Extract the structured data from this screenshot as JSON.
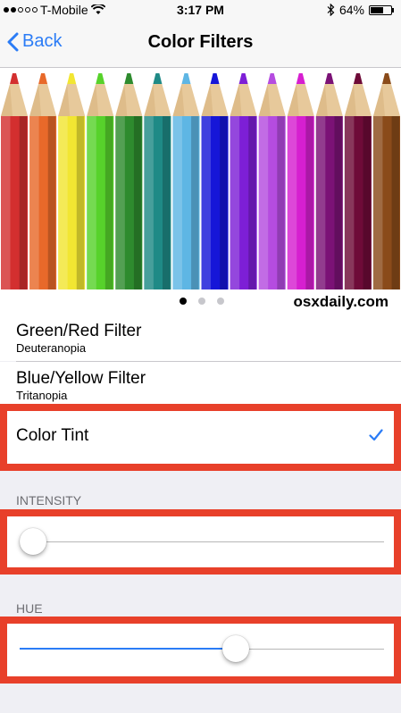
{
  "status_bar": {
    "carrier": "T-Mobile",
    "signal_bars_filled": 2,
    "signal_bars_total": 5,
    "time": "3:17 PM",
    "battery_percent": "64%",
    "battery_level": 0.64,
    "icons": [
      "wifi-icon",
      "bluetooth-icon",
      "battery-icon"
    ]
  },
  "nav": {
    "back_label": "Back",
    "title": "Color Filters"
  },
  "hero": {
    "watermark": "osxdaily.com",
    "page_count": 3,
    "active_page": 1,
    "pencil_colors": [
      "#d32f2f",
      "#e8692a",
      "#f2e632",
      "#57d22b",
      "#2e8b2e",
      "#1f8a86",
      "#5eb6e4",
      "#1616d8",
      "#7d1fd6",
      "#b54ce0",
      "#d61fd0",
      "#7b1276",
      "#6e0b38",
      "#8a4b1a"
    ]
  },
  "filters": [
    {
      "title": "Green/Red Filter",
      "subtitle": "Deuteranopia"
    },
    {
      "title": "Blue/Yellow Filter",
      "subtitle": "Tritanopia"
    },
    {
      "title": "Color Tint",
      "selected": true
    }
  ],
  "intensity": {
    "label": "INTENSITY",
    "value": 0.0
  },
  "hue": {
    "label": "HUE",
    "value": 0.6
  },
  "colors": {
    "accent": "#2b7cf6",
    "highlight": "#e8402a"
  }
}
